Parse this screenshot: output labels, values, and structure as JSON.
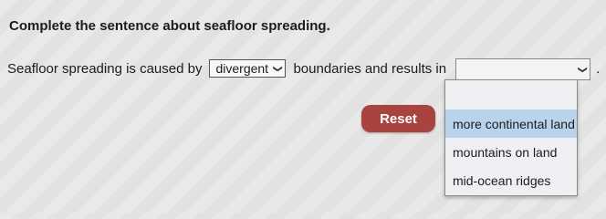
{
  "question": "Complete the sentence about seafloor spreading.",
  "sentence": {
    "part1": "Seafloor spreading is caused by",
    "part2": "boundaries and results in",
    "end": "."
  },
  "select1": {
    "value": "divergent"
  },
  "select2": {
    "value": ""
  },
  "dropdown": {
    "options": [
      "",
      "more continental land",
      "mountains on land",
      "mid-ocean ridges"
    ],
    "highlighted": "more continental land"
  },
  "reset_label": "Reset",
  "colors": {
    "reset": "#a8433f",
    "highlight": "#b9d3ec"
  },
  "icons": {
    "dropdown": "chevron-down-icon"
  }
}
